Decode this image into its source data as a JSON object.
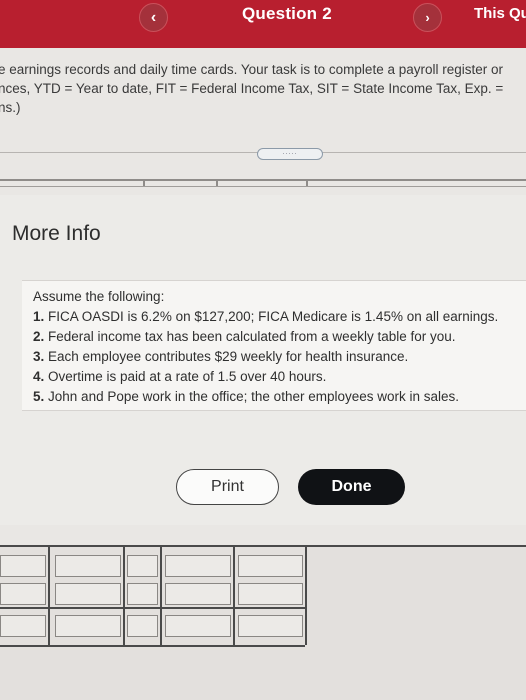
{
  "header": {
    "title": "Question 2",
    "prev_icon": "‹",
    "next_icon": "›",
    "this_question_label": "This Qu"
  },
  "instructions": {
    "line1": "e earnings records and daily time cards. Your task is to complete a payroll register or",
    "line2": "nces, YTD = Year to date, FIT = Federal Income Tax, SIT = State Income Tax, Exp. =",
    "line3": "ns.)"
  },
  "expander": {
    "label": "....."
  },
  "modal": {
    "title": "More Info",
    "intro": "Assume the following:",
    "items": [
      {
        "num": "1.",
        "text": "FICA OASDI is 6.2% on $127,200; FICA Medicare is 1.45% on all earnings."
      },
      {
        "num": "2.",
        "text": "Federal income tax has been calculated from a weekly table for you."
      },
      {
        "num": "3.",
        "text": "Each employee contributes $29 weekly for health insurance."
      },
      {
        "num": "4.",
        "text": "Overtime is paid at a rate of 1.5 over 40 hours."
      },
      {
        "num": "5.",
        "text": "John and Pope work in the office; the other employees work in sales."
      }
    ],
    "print_label": "Print",
    "done_label": "Done"
  },
  "colors": {
    "header_bg": "#b81f2f",
    "done_bg": "#101215"
  }
}
